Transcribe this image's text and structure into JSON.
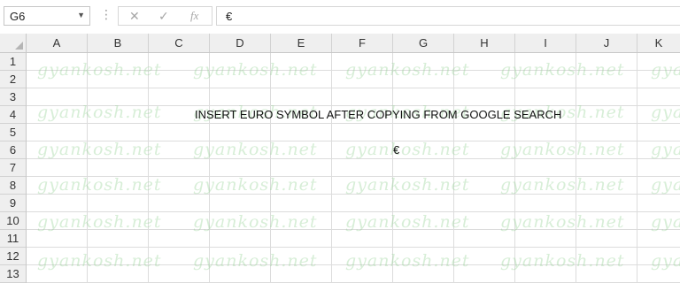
{
  "formula_bar": {
    "name_box": "G6",
    "cancel_icon": "✕",
    "enter_icon": "✓",
    "fx_label": "fx",
    "formula": "€"
  },
  "columns": [
    "A",
    "B",
    "C",
    "D",
    "E",
    "F",
    "G",
    "H",
    "I",
    "J",
    "K"
  ],
  "rows": [
    "1",
    "2",
    "3",
    "4",
    "5",
    "6",
    "7",
    "8",
    "9",
    "10",
    "11",
    "12",
    "13"
  ],
  "cells": {
    "row4_text": "INSERT EURO SYMBOL AFTER COPYING FROM GOOGLE SEARCH",
    "g6": "€"
  },
  "watermark": "gyankosh.net"
}
